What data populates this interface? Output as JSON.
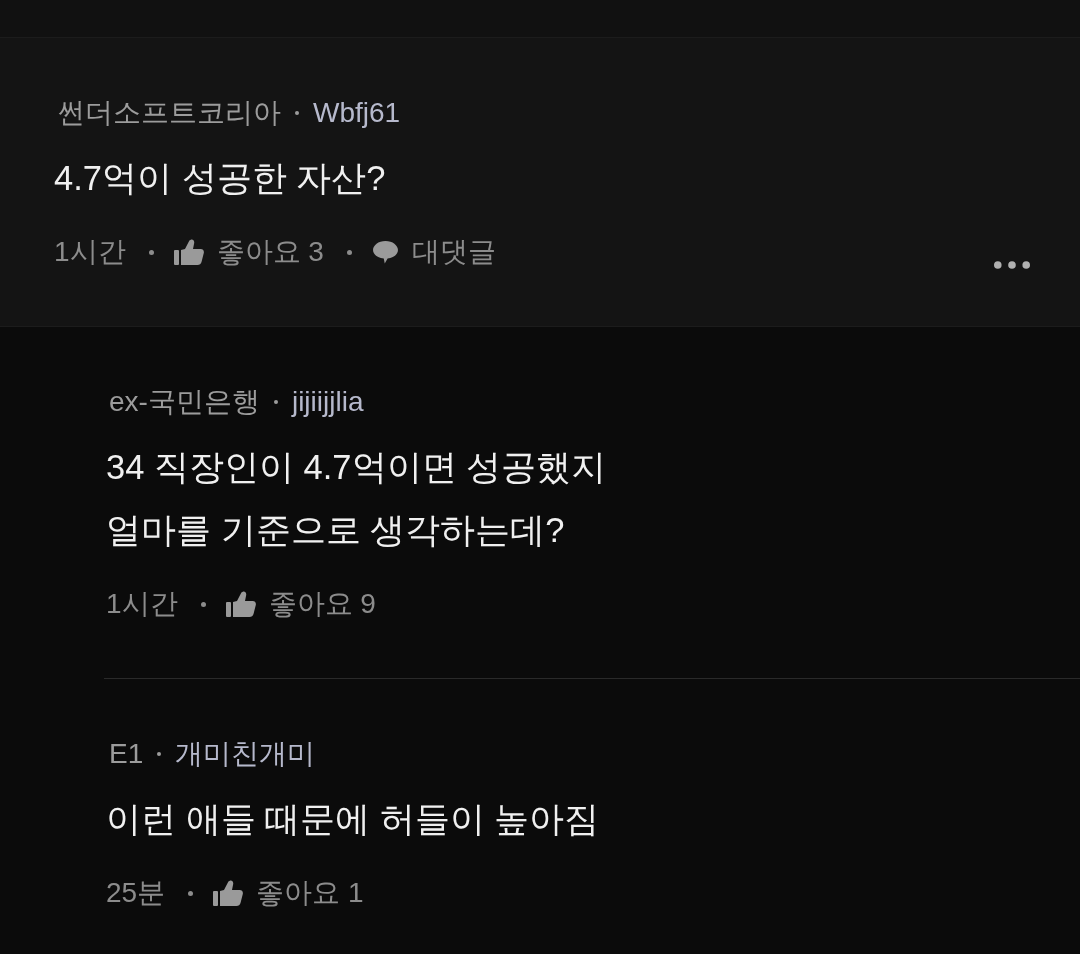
{
  "comment": {
    "company": "썬더소프트코리아",
    "nickname": "Wbfj61",
    "text": "4.7억이 성공한 자산?",
    "time": "1시간",
    "likes": "좋아요 3",
    "reply_button": "대댓글"
  },
  "replies": [
    {
      "company": "ex-국민은행",
      "nickname": "jijiijjlia",
      "text": "34 직장인이 4.7억이면 성공했지\n얼마를 기준으로 생각하는데?",
      "time": "1시간",
      "likes": "좋아요 9"
    },
    {
      "company": "E1",
      "nickname": "개미친개미",
      "text": "이런 애들 때문에 허들이 높아짐",
      "time": "25분",
      "likes": "좋아요 1"
    }
  ]
}
